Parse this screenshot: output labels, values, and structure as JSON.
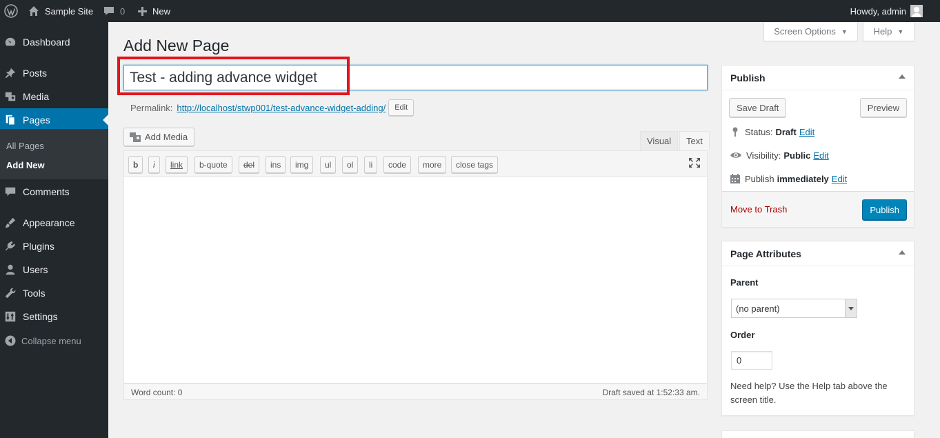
{
  "admin_bar": {
    "site_name": "Sample Site",
    "comments_count": "0",
    "new_label": "New",
    "howdy": "Howdy, admin"
  },
  "menu": {
    "dashboard": "Dashboard",
    "posts": "Posts",
    "media": "Media",
    "pages": "Pages",
    "all_pages": "All Pages",
    "add_new": "Add New",
    "comments": "Comments",
    "appearance": "Appearance",
    "plugins": "Plugins",
    "users": "Users",
    "tools": "Tools",
    "settings": "Settings",
    "collapse": "Collapse menu"
  },
  "screen_meta": {
    "screen_options": "Screen Options",
    "help": "Help"
  },
  "page": {
    "heading": "Add New Page",
    "title_value": "Test - adding advance widget",
    "permalink_label": "Permalink:",
    "permalink_url": "http://localhost/stwp001/test-advance-widget-adding/",
    "permalink_edit": "Edit"
  },
  "editor": {
    "add_media": "Add Media",
    "tab_visual": "Visual",
    "tab_text": "Text",
    "buttons": [
      "b",
      "i",
      "link",
      "b-quote",
      "del",
      "ins",
      "img",
      "ul",
      "ol",
      "li",
      "code",
      "more",
      "close tags"
    ],
    "word_count": "Word count: 0",
    "draft_saved": "Draft saved at 1:52:33 am."
  },
  "publish": {
    "title": "Publish",
    "save_draft": "Save Draft",
    "preview": "Preview",
    "status_label": "Status:",
    "status_value": "Draft",
    "visibility_label": "Visibility:",
    "visibility_value": "Public",
    "publish_label": "Publish",
    "publish_value": "immediately",
    "edit": "Edit",
    "move_to_trash": "Move to Trash",
    "publish_button": "Publish"
  },
  "page_attributes": {
    "title": "Page Attributes",
    "parent_label": "Parent",
    "parent_value": "(no parent)",
    "order_label": "Order",
    "order_value": "0",
    "help_text": "Need help? Use the Help tab above the screen title."
  },
  "colors": {
    "accent": "#0073aa",
    "admin_dark": "#23282d",
    "highlight": "#e3141c",
    "trash": "#aa0000"
  }
}
